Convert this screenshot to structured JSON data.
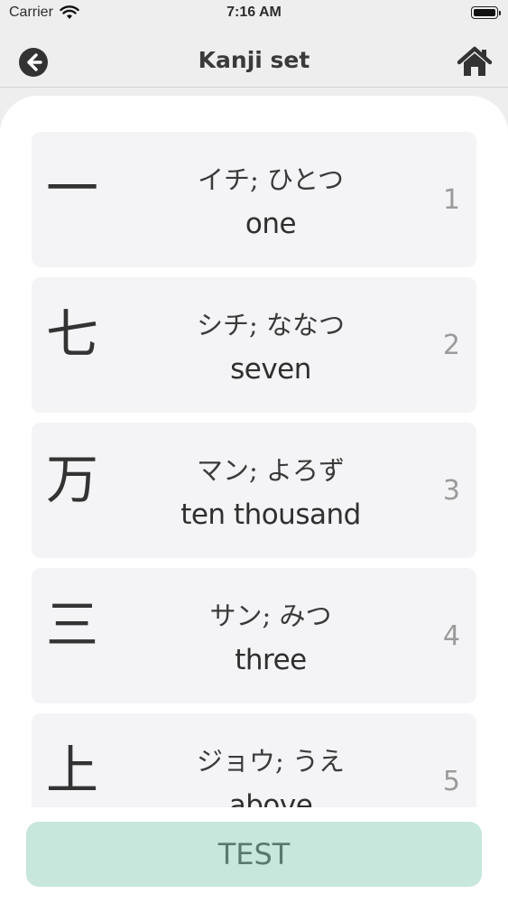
{
  "status_bar": {
    "carrier": "Carrier",
    "time": "7:16 AM"
  },
  "navbar": {
    "title": "Kanji set"
  },
  "cards": [
    {
      "kanji": "一",
      "reading": "イチ; ひとつ",
      "meaning": "one",
      "number": "1"
    },
    {
      "kanji": "七",
      "reading": "シチ; ななつ",
      "meaning": "seven",
      "number": "2"
    },
    {
      "kanji": "万",
      "reading": "マン; よろず",
      "meaning": "ten thousand",
      "number": "3"
    },
    {
      "kanji": "三",
      "reading": "サン; みつ",
      "meaning": "three",
      "number": "4"
    },
    {
      "kanji": "上",
      "reading": "ジョウ; うえ",
      "meaning": "above",
      "number": "5"
    }
  ],
  "test_button": {
    "label": "TEST"
  },
  "colors": {
    "accent": "#c7e6dc",
    "accent_text": "#587a6e",
    "card_bg": "#f4f3f5"
  }
}
